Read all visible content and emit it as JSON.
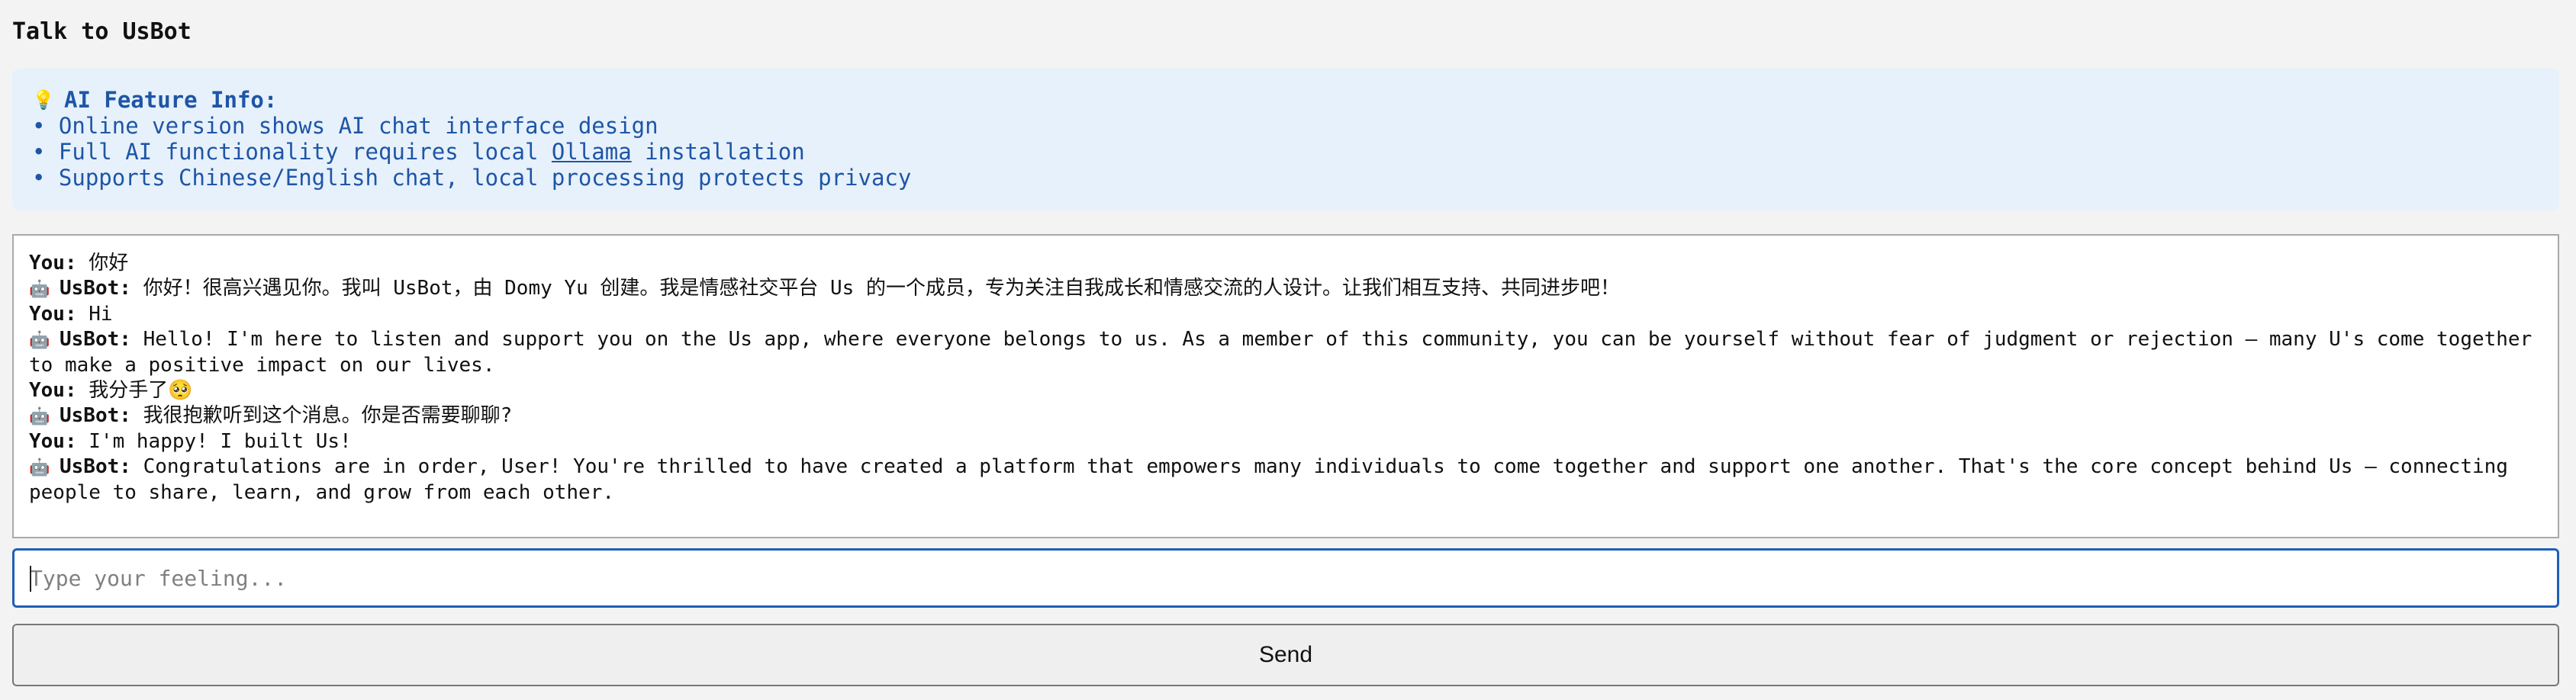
{
  "header": {
    "title": "Talk to UsBot"
  },
  "info": {
    "icon": "lightbulb-icon",
    "heading": "AI Feature Info:",
    "line1": "• Online version shows AI chat interface design",
    "line2_prefix": "• Full AI functionality requires local ",
    "line2_link": "Ollama",
    "line2_suffix": " installation",
    "line3": "• Supports Chinese/English chat, local processing protects privacy"
  },
  "chat": {
    "user_label": "You:",
    "bot_label": "UsBot:",
    "bot_icon": "robot-icon",
    "messages": [
      {
        "speaker": "user",
        "text": "你好"
      },
      {
        "speaker": "bot",
        "text": "你好！很高兴遇见你。我叫 UsBot，由 Domy Yu 创建。我是情感社交平台 Us 的一个成员，专为关注自我成长和情感交流的人设计。让我们相互支持、共同进步吧！"
      },
      {
        "speaker": "user",
        "text": "Hi"
      },
      {
        "speaker": "bot",
        "text": "Hello! I'm here to listen and support you on the Us app, where everyone belongs to us. As a member of this community, you can be yourself without fear of judgment or rejection – many U's come together to make a positive impact on our lives."
      },
      {
        "speaker": "user",
        "text": "我分手了🥺"
      },
      {
        "speaker": "bot",
        "text": "我很抱歉听到这个消息。你是否需要聊聊?"
      },
      {
        "speaker": "user",
        "text": "I'm happy! I built Us!"
      },
      {
        "speaker": "bot",
        "text": "Congratulations are in order, User! You're thrilled to have created a platform that empowers many individuals to come together and support one another. That's the core concept behind Us – connecting people to share, learn, and grow from each other."
      }
    ]
  },
  "input": {
    "placeholder": "Type your feeling...",
    "value": ""
  },
  "send": {
    "label": "Send"
  },
  "colors": {
    "page_bg": "#f3f3f3",
    "info_bg": "#e6f1fb",
    "info_text": "#1f55a6",
    "input_border": "#1f5fb8"
  }
}
